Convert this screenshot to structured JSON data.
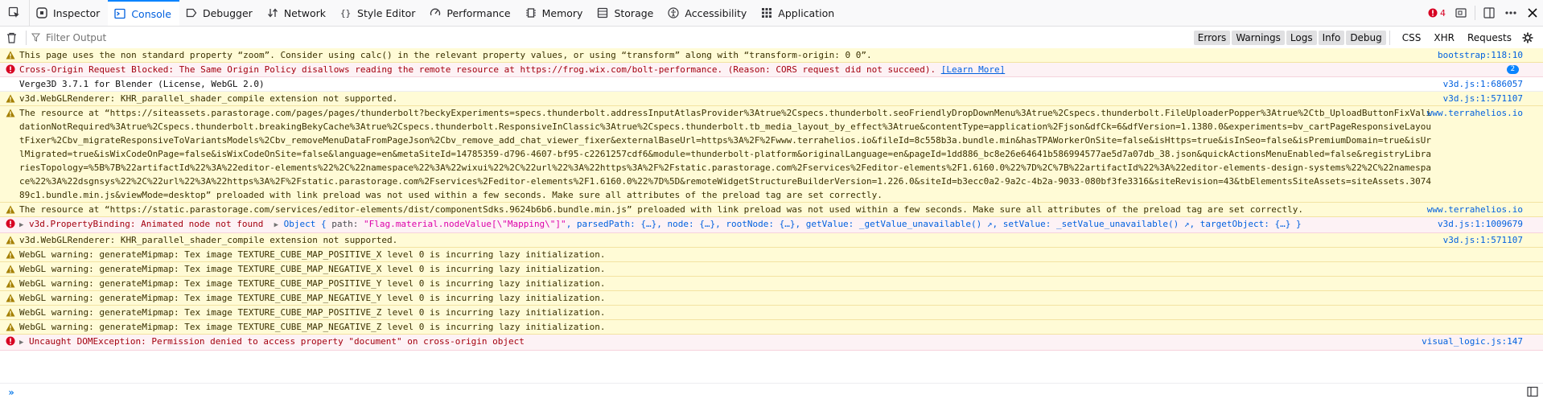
{
  "toolbar": {
    "tabs": [
      {
        "label": "Inspector",
        "icon": "inspector-icon"
      },
      {
        "label": "Console",
        "icon": "console-icon",
        "active": true
      },
      {
        "label": "Debugger",
        "icon": "debugger-icon"
      },
      {
        "label": "Network",
        "icon": "network-icon"
      },
      {
        "label": "Style Editor",
        "icon": "style-editor-icon"
      },
      {
        "label": "Performance",
        "icon": "performance-icon"
      },
      {
        "label": "Memory",
        "icon": "memory-icon"
      },
      {
        "label": "Storage",
        "icon": "storage-icon"
      },
      {
        "label": "Accessibility",
        "icon": "accessibility-icon"
      },
      {
        "label": "Application",
        "icon": "application-icon"
      }
    ],
    "error_count": "4"
  },
  "filter": {
    "placeholder": "Filter Output",
    "levels": [
      {
        "label": "Errors",
        "on": true
      },
      {
        "label": "Warnings",
        "on": true
      },
      {
        "label": "Logs",
        "on": true
      },
      {
        "label": "Info",
        "on": true
      },
      {
        "label": "Debug",
        "on": true
      }
    ],
    "extras": [
      "CSS",
      "XHR",
      "Requests"
    ]
  },
  "messages": [
    {
      "level": "warn",
      "text": "This page uses the non standard property “zoom”. Consider using calc() in the relevant property values, or using “transform” along with “transform-origin: 0 0”.",
      "source": "bootstrap:118:10"
    },
    {
      "level": "error",
      "text": "Cross-Origin Request Blocked: The Same Origin Policy disallows reading the remote resource at https://frog.wix.com/bolt-performance. (Reason: CORS request did not succeed).",
      "link": "[Learn More]",
      "badge": "2"
    },
    {
      "level": "log",
      "text": "Verge3D 3.7.1 for Blender (License, WebGL 2.0)",
      "source": "v3d.js:1:686057"
    },
    {
      "level": "warn",
      "text": "v3d.WebGLRenderer: KHR_parallel_shader_compile extension not supported.",
      "source": "v3d.js:1:571107"
    },
    {
      "level": "warn",
      "text": "The resource at “https://siteassets.parastorage.com/pages/pages/thunderbolt?beckyExperiments=specs.thunderbolt.addressInputAtlasProvider%3Atrue%2Cspecs.thunderbolt.seoFriendlyDropDownMenu%3Atrue%2Cspecs.thunderbolt.FileUploaderPopper%3Atrue%2Ctb_UploadButtonFixValidationNotRequired%3Atrue%2Cspecs.thunderbolt.breakingBekyCache%3Atrue%2Cspecs.thunderbolt.ResponsiveInClassic%3Atrue%2Cspecs.thunderbolt.tb_media_layout_by_effect%3Atrue&contentType=application%2Fjson&dfCk=6&dfVersion=1.1380.0&experiments=bv_cartPageResponsiveLayoutFixer%2Cbv_migrateResponsiveToVariantsModels%2Cbv_removeMenuDataFromPageJson%2Cbv_remove_add_chat_viewer_fixer&externalBaseUrl=https%3A%2F%2Fwww.terrahelios.io&fileId=8c558b3a.bundle.min&hasTPAWorkerOnSite=false&isHttps=true&isInSeo=false&isPremiumDomain=true&isUrlMigrated=true&isWixCodeOnPage=false&isWixCodeOnSite=false&language=en&metaSiteId=14785359-d796-4607-bf95-c2261257cdf6&module=thunderbolt-platform&originalLanguage=en&pageId=1dd886_bc8e26e64641b586994577ae5d7a07db_38.json&quickActionsMenuEnabled=false&registryLibrariesTopology=%5B%7B%22artifactId%22%3A%22editor-elements%22%2C%22namespace%22%3A%22wixui%22%2C%22url%22%3A%22https%3A%2F%2Fstatic.parastorage.com%2Fservices%2Feditor-elements%2F1.6160.0%22%7D%2C%7B%22artifactId%22%3A%22editor-elements-design-systems%22%2C%22namespace%22%3A%22dsgnsys%22%2C%22url%22%3A%22https%3A%2F%2Fstatic.parastorage.com%2Fservices%2Feditor-elements%2F1.6160.0%22%7D%5D&remoteWidgetStructureBuilderVersion=1.226.0&siteId=b3ecc0a2-9a2c-4b2a-9033-080bf3fe3316&siteRevision=43&tbElementsSiteAssets=siteAssets.307489c1.bundle.min.js&viewMode=desktop” preloaded with link preload was not used within a few seconds. Make sure all attributes of the preload tag are set correctly.",
      "source": "www.terrahelios.io"
    },
    {
      "level": "warn",
      "text": "The resource at “https://static.parastorage.com/services/editor-elements/dist/componentSdks.9624b6b6.bundle.min.js” preloaded with link preload was not used within a few seconds. Make sure all attributes of the preload tag are set correctly.",
      "source": "www.terrahelios.io"
    },
    {
      "level": "error",
      "expandable": true,
      "text": "v3d.PropertyBinding: Animated node not found",
      "object": {
        "prefix": "Object {",
        "path_key": "path:",
        "path_val": "\"Flag.material.nodeValue[\\\"Mapping\\\"]\"",
        "rest": ", parsedPath: {…}, node: {…}, rootNode: {…}, getValue: _getValue_unavailable() ↗, setValue: _setValue_unavailable() ↗, targetObject: {…} }"
      },
      "source": "v3d.js:1:1009679"
    },
    {
      "level": "warn",
      "text": "v3d.WebGLRenderer: KHR_parallel_shader_compile extension not supported.",
      "source": "v3d.js:1:571107"
    },
    {
      "level": "warn",
      "text": "WebGL warning: generateMipmap: Tex image TEXTURE_CUBE_MAP_POSITIVE_X level 0 is incurring lazy initialization."
    },
    {
      "level": "warn",
      "text": "WebGL warning: generateMipmap: Tex image TEXTURE_CUBE_MAP_NEGATIVE_X level 0 is incurring lazy initialization."
    },
    {
      "level": "warn",
      "text": "WebGL warning: generateMipmap: Tex image TEXTURE_CUBE_MAP_POSITIVE_Y level 0 is incurring lazy initialization."
    },
    {
      "level": "warn",
      "text": "WebGL warning: generateMipmap: Tex image TEXTURE_CUBE_MAP_NEGATIVE_Y level 0 is incurring lazy initialization."
    },
    {
      "level": "warn",
      "text": "WebGL warning: generateMipmap: Tex image TEXTURE_CUBE_MAP_POSITIVE_Z level 0 is incurring lazy initialization."
    },
    {
      "level": "warn",
      "text": "WebGL warning: generateMipmap: Tex image TEXTURE_CUBE_MAP_NEGATIVE_Z level 0 is incurring lazy initialization."
    },
    {
      "level": "error",
      "expandable": true,
      "text": "Uncaught DOMException: Permission denied to access property \"document\" on cross-origin object",
      "source": "visual_logic.js:147"
    }
  ],
  "colors": {
    "warn_bg": "#fffbd6",
    "error_bg": "#fdf2f5",
    "link": "#0060df",
    "accent": "#0a84ff"
  }
}
